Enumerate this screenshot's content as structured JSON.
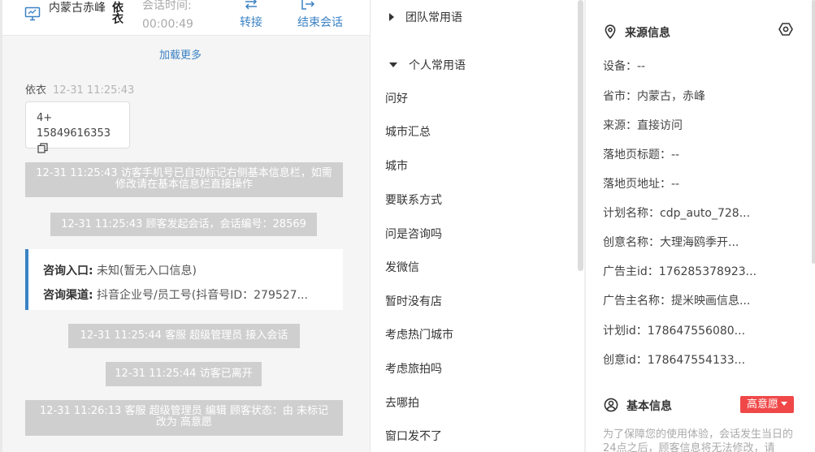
{
  "header": {
    "location": "内蒙古赤峰",
    "visitor_name": "依衣",
    "session_time_label": "会话时间:",
    "session_time": "00:00:49",
    "transfer_label": "转接",
    "end_label": "结束会话"
  },
  "chat": {
    "load_more": "加载更多",
    "visitor_name": "依衣",
    "message_time": "12-31 11:25:43",
    "message_line1": "4+",
    "message_line2": "15849616353",
    "sys1": "12-31 11:25:43 访客手机号已自动标记右侧基本信息栏，如需修改请在基本信息栏直接操作",
    "sys2": "12-31 11:25:43 顾客发起会话，会话编号：28569",
    "entry_label": "咨询入口:",
    "entry_value": " 未知(暂无入口信息)",
    "channel_label": "咨询渠道:",
    "channel_value": " 抖音企业号/员工号(抖音号ID：279527...",
    "sys3": "12-31 11:25:44 客服 超级管理员 接入会话",
    "sys4": "12-31 11:25:44 访客已离开",
    "sys5": "12-31 11:26:13 客服 超级管理员 编辑 顾客状态：由 未标记 改为 高意愿"
  },
  "phrases": {
    "team_group": "团队常用语",
    "personal_group": "个人常用语",
    "items": [
      "问好",
      "城市汇总",
      "城市",
      "要联系方式",
      "问是咨询吗",
      "发微信",
      "暂时没有店",
      "考虑热门城市",
      "考虑旅拍吗",
      "去哪拍",
      "窗口发不了"
    ]
  },
  "source_info": {
    "title": "来源信息",
    "fields": [
      "设备：--",
      "省市：内蒙古，赤峰",
      "来源：直接访问",
      "落地页标题：--",
      "落地页地址：--",
      "计划名称：cdp_auto_728...",
      "创意名称：大理海鸥季开...",
      "广告主id：176285378923...",
      "广告主名称：提米映画信息...",
      "计划id：178647556080...",
      "创意id：178647554133..."
    ]
  },
  "basic_info": {
    "title": "基本信息",
    "status_badge": "高意愿",
    "notice": "为了保障您的使用体验，会话发生当日的24点之后，顾客信息将无法修改，请"
  },
  "colors": {
    "accent": "#3b82c4",
    "badge": "#f04848",
    "system_message": "#cfcfcf"
  }
}
